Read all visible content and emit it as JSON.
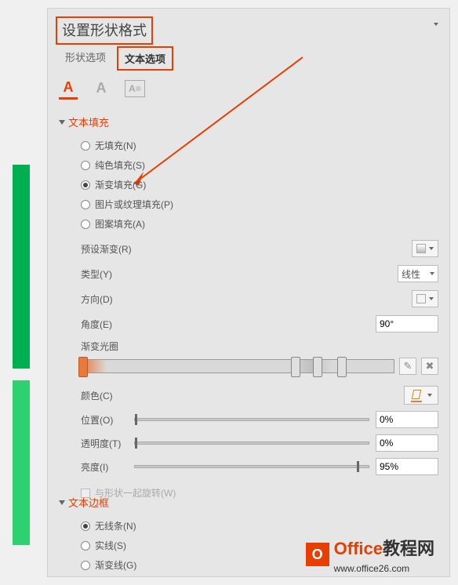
{
  "panel_title": "设置形状格式",
  "tabs": {
    "shape": "形状选项",
    "text": "文本选项"
  },
  "sections": {
    "fill": "文本填充",
    "border": "文本边框"
  },
  "fill_options": {
    "none": "无填充(N)",
    "solid": "纯色填充(S)",
    "gradient": "渐变填充(G)",
    "picture": "图片或纹理填充(P)",
    "pattern": "图案填充(A)"
  },
  "gradient_props": {
    "preset": "预设渐变(R)",
    "type_label": "类型(Y)",
    "type_value": "线性",
    "direction": "方向(D)",
    "angle_label": "角度(E)",
    "angle_value": "90°",
    "stops_label": "渐变光圈",
    "color_label": "颜色(C)",
    "position_label": "位置(O)",
    "position_value": "0%",
    "transparency_label": "透明度(T)",
    "transparency_value": "0%",
    "brightness_label": "亮度(I)",
    "brightness_value": "95%",
    "rotate": "与形状一起旋转(W)"
  },
  "border_options": {
    "none": "无线条(N)",
    "solid": "实线(S)",
    "gradient": "渐变线(G)"
  },
  "chart_data": {
    "type": "bar",
    "note": "gradient stop positions",
    "stops": [
      0,
      67,
      74,
      82
    ]
  },
  "watermark": {
    "brand": "Office",
    "suffix": "教程网",
    "url": "www.office26.com"
  }
}
